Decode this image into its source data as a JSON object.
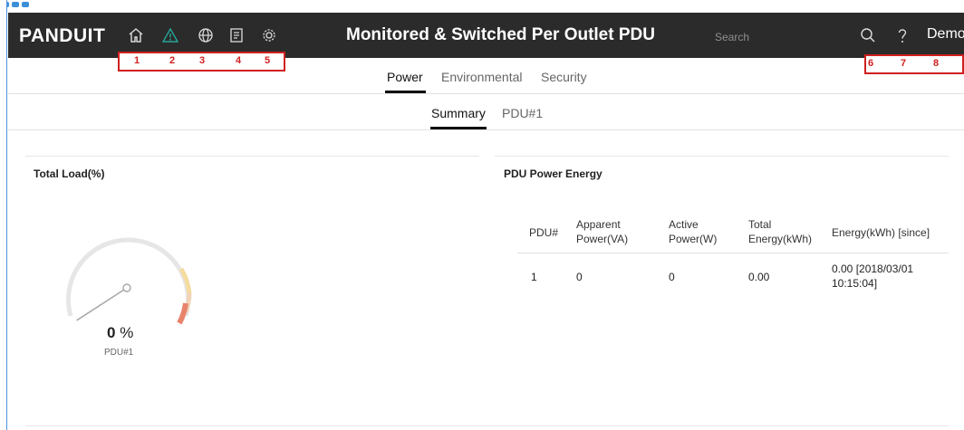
{
  "header": {
    "logo": "PANDUIT",
    "title": "Monitored & Switched Per Outlet PDU",
    "search_placeholder": "Search",
    "user": "Demo",
    "nav_icons": [
      "home-icon",
      "warning-icon",
      "globe-icon",
      "document-icon",
      "gear-icon"
    ],
    "right_icons": [
      "search-icon",
      "help-icon"
    ],
    "colors": {
      "bar": "#2b2b2b",
      "warning": "#26a69a",
      "annotation": "#d0201f"
    }
  },
  "annotations": {
    "left": [
      "1",
      "2",
      "3",
      "4",
      "5"
    ],
    "right": [
      "6",
      "7",
      "8"
    ]
  },
  "tabs": {
    "primary": [
      "Power",
      "Environmental",
      "Security"
    ],
    "secondary": [
      "Summary",
      "PDU#1"
    ]
  },
  "total_load": {
    "title": "Total Load(%)",
    "value": "0",
    "unit": "%",
    "label": "PDU#1",
    "load_fraction": 0
  },
  "energy": {
    "title": "PDU Power Energy",
    "columns": [
      "PDU#",
      "Apparent Power(VA)",
      "Active Power(W)",
      "Total Energy(kWh)",
      "Energy(kWh) [since]"
    ],
    "rows": [
      [
        "1",
        "0",
        "0",
        "0.00",
        "0.00 [2018/03/01 10:15:04]"
      ]
    ]
  }
}
